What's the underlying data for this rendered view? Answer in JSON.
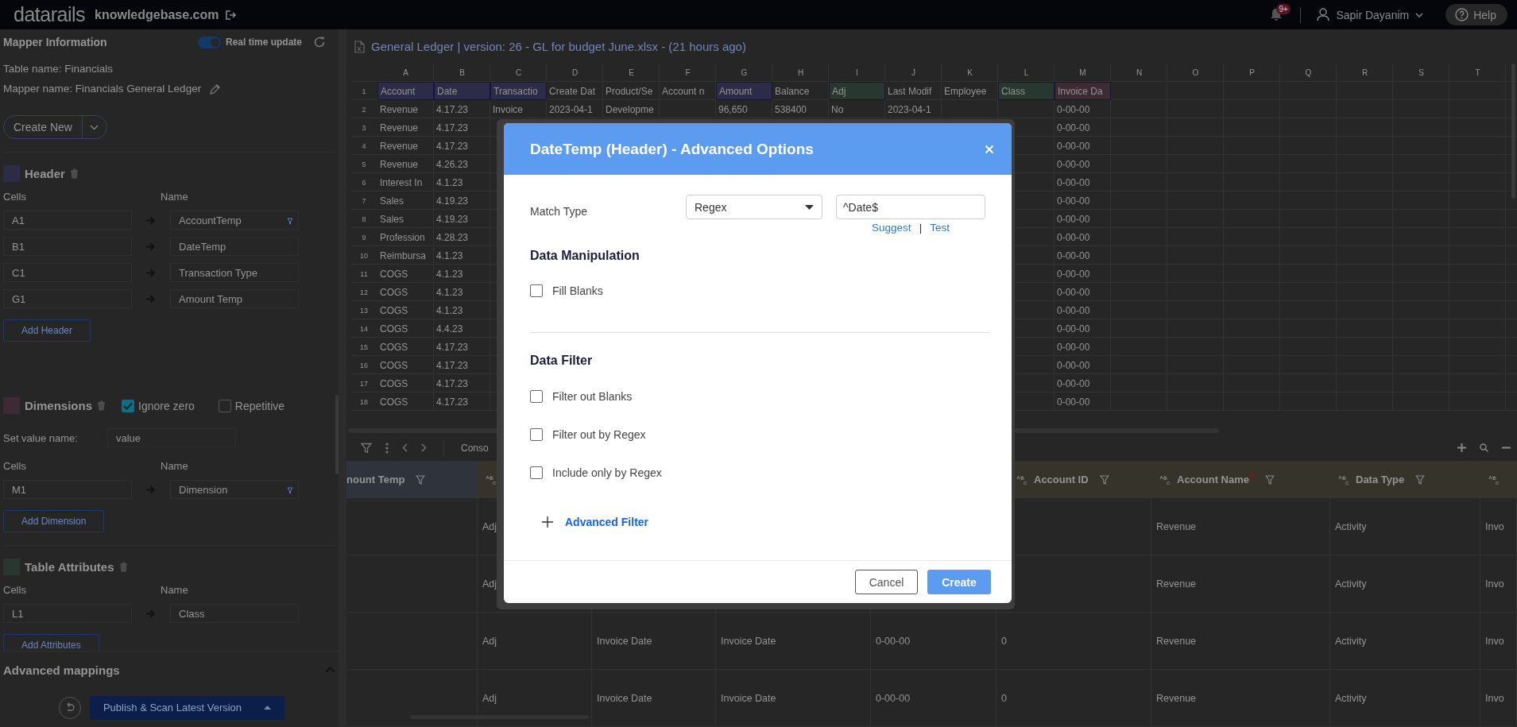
{
  "topbar": {
    "logo": "datarails",
    "domain": "knowledgebase.com",
    "badge": "9+",
    "user": "Sapir Dayanim",
    "help": "Help"
  },
  "mapper": {
    "title": "Mapper Information",
    "realtime": {
      "label": "Real time update",
      "on": true
    },
    "table_name": "Table name: Financials",
    "mapper_name": "Mapper name: Financials General Ledger",
    "create_button": "Create New",
    "sections": [
      {
        "title": "Header",
        "color": "#2c2c48",
        "cells_label": "Cells",
        "name_label": "Name",
        "rows": [
          {
            "cell": "A1",
            "name": "AccountTemp",
            "dropdown": true
          },
          {
            "cell": "B1",
            "name": "DateTemp",
            "dropdown": false
          },
          {
            "cell": "C1",
            "name": "Transaction Type",
            "dropdown": false
          },
          {
            "cell": "G1",
            "name": "Amount Temp",
            "dropdown": false
          }
        ],
        "add_button": "Add Header"
      },
      {
        "title": "Dimensions",
        "color": "#3c2a35",
        "options": [
          {
            "label": "Ignore zero",
            "checked": true
          },
          {
            "label": "Repetitive",
            "checked": false
          }
        ],
        "value_label": "Set value name:",
        "value": "value",
        "cells_label": "Cells",
        "name_label": "Name",
        "rows": [
          {
            "cell": "M1",
            "name": "Dimension",
            "dropdown": true
          }
        ],
        "add_button": "Add Dimension"
      },
      {
        "title": "Table Attributes",
        "color": "#283830",
        "cells_label": "Cells",
        "name_label": "Name",
        "rows": [
          {
            "cell": "L1",
            "name": "Class",
            "dropdown": false
          }
        ],
        "add_button": "Add Attributes"
      }
    ],
    "advanced": {
      "title": "Advanced mappings",
      "expanded": true
    },
    "publish_button": "Publish & Scan Latest Version"
  },
  "sheet": {
    "title": "General Ledger | version: 26 - GL for budget June.xlsx - (21 hours ago)",
    "columns": [
      "A",
      "B",
      "C",
      "D",
      "E",
      "F",
      "G",
      "H",
      "I",
      "J",
      "K",
      "L",
      "M",
      "N",
      "O",
      "P",
      "Q",
      "R",
      "S",
      "T"
    ],
    "rows": [
      {
        "number": "1",
        "cells": [
          {
            "text": "Account",
            "color": "#2c2c48"
          },
          {
            "text": "Date",
            "color": "#2c2c48"
          },
          {
            "text": "Transactio",
            "color": "#2c2c48"
          },
          {
            "text": "Create Dat"
          },
          {
            "text": "Product/Se"
          },
          {
            "text": "Account n"
          },
          {
            "text": "Amount",
            "color": "#2c2c48"
          },
          {
            "text": "Balance"
          },
          {
            "text": "Adj",
            "color": "#283830"
          },
          {
            "text": "Last Modif"
          },
          {
            "text": "Employee"
          },
          {
            "text": "Class",
            "color": "#283830"
          },
          {
            "text": "Invoice Da",
            "color": "#3c2a35"
          }
        ]
      },
      {
        "number": "2",
        "cells": [
          "Revenue",
          "4.17.23",
          "Invoice",
          "2023-04-1",
          "Developme",
          null,
          "96,650",
          "538400",
          "No",
          "2023-04-1",
          null,
          null,
          "0-00-00"
        ]
      },
      {
        "number": "3",
        "cells": [
          "Revenue",
          "4.17.23",
          null,
          null,
          null,
          null,
          null,
          null,
          null,
          null,
          null,
          null,
          "0-00-00"
        ]
      },
      {
        "number": "4",
        "cells": [
          "Revenue",
          "4.17.23",
          null,
          null,
          null,
          null,
          null,
          null,
          null,
          null,
          null,
          null,
          "0-00-00"
        ]
      },
      {
        "number": "5",
        "cells": [
          "Revenue",
          "4.26.23",
          null,
          null,
          null,
          null,
          null,
          null,
          null,
          null,
          null,
          null,
          "0-00-00"
        ]
      },
      {
        "number": "6",
        "cells": [
          "Interest In",
          "4.1.23",
          null,
          null,
          null,
          null,
          null,
          null,
          null,
          null,
          null,
          null,
          "0-00-00"
        ]
      },
      {
        "number": "7",
        "cells": [
          "Sales",
          "4.19.23",
          null,
          null,
          null,
          null,
          null,
          null,
          null,
          null,
          null,
          null,
          "0-00-00"
        ]
      },
      {
        "number": "8",
        "cells": [
          "Sales",
          "4.19.23",
          null,
          null,
          null,
          null,
          null,
          null,
          null,
          null,
          null,
          null,
          "0-00-00"
        ]
      },
      {
        "number": "9",
        "cells": [
          "Profession",
          "4.28.23",
          null,
          null,
          null,
          null,
          null,
          null,
          null,
          null,
          null,
          null,
          "0-00-00"
        ]
      },
      {
        "number": "10",
        "cells": [
          "Reimbursa",
          "4.1.23",
          null,
          null,
          null,
          null,
          null,
          null,
          null,
          null,
          null,
          null,
          "0-00-00"
        ]
      },
      {
        "number": "11",
        "cells": [
          "COGS",
          "4.1.23",
          null,
          null,
          null,
          null,
          null,
          null,
          null,
          null,
          null,
          null,
          "0-00-00"
        ]
      },
      {
        "number": "12",
        "cells": [
          "COGS",
          "4.1.23",
          null,
          null,
          null,
          null,
          null,
          null,
          null,
          null,
          null,
          null,
          "0-00-00"
        ]
      },
      {
        "number": "13",
        "cells": [
          "COGS",
          "4.1.23",
          null,
          null,
          null,
          null,
          null,
          null,
          null,
          null,
          null,
          null,
          "0-00-00"
        ]
      },
      {
        "number": "14",
        "cells": [
          "COGS",
          "4.4.23",
          null,
          null,
          null,
          null,
          null,
          null,
          null,
          null,
          null,
          null,
          "0-00-00"
        ]
      },
      {
        "number": "15",
        "cells": [
          "COGS",
          "4.17.23",
          null,
          null,
          null,
          null,
          null,
          null,
          null,
          null,
          null,
          null,
          "0-00-00"
        ]
      },
      {
        "number": "16",
        "cells": [
          "COGS",
          "4.17.23",
          null,
          null,
          null,
          null,
          null,
          null,
          null,
          null,
          null,
          null,
          "0-00-00"
        ]
      },
      {
        "number": "17",
        "cells": [
          "COGS",
          "4.17.23",
          null,
          null,
          null,
          null,
          null,
          null,
          null,
          null,
          null,
          null,
          "0-00-00"
        ]
      },
      {
        "number": "18",
        "cells": [
          "COGS",
          "4.17.23",
          null,
          null,
          null,
          null,
          null,
          null,
          null,
          null,
          null,
          null,
          "0-00-00"
        ]
      }
    ]
  },
  "grid": {
    "tab": "Conso",
    "columns": [
      {
        "title": "nount Temp",
        "filter": true,
        "color": "#2e333c"
      },
      {
        "type_icon": true,
        "color": "#35332a"
      },
      {},
      {},
      {},
      {
        "title": "Account ID",
        "type_icon": true,
        "filter": true,
        "color": "#35332a"
      },
      {
        "title": "Account Name",
        "type_icon": true,
        "filter": true,
        "required": true,
        "color": "#35332a"
      },
      {
        "title": "Data Type",
        "type_icon": true,
        "filter": true,
        "color": "#35332a"
      },
      {
        "type_icon": true,
        "color": "#35332a"
      }
    ],
    "rows": [
      {
        "cells": [
          null,
          "Adj",
          null,
          null,
          null,
          null,
          "Revenue",
          "Activity",
          "Invo"
        ]
      },
      {
        "cells": [
          null,
          "Adj",
          null,
          null,
          null,
          null,
          "Revenue",
          "Activity",
          "Invo"
        ]
      },
      {
        "cells": [
          null,
          "Adj",
          "Invoice Date",
          "Invoice Date",
          "0-00-00",
          "0",
          "Revenue",
          "Activity",
          "Invo"
        ]
      },
      {
        "cells": [
          null,
          "Adj",
          "Invoice Date",
          "Invoice Date",
          "0-00-00",
          "0",
          "Revenue",
          "Activity",
          "Invo"
        ]
      }
    ]
  },
  "modal": {
    "title": "DateTemp (Header) - Advanced Options",
    "match_label": "Match Type",
    "match_type": "Regex",
    "pattern": "^Date$",
    "links": [
      "Suggest",
      "Test"
    ],
    "separator": "|",
    "sections": [
      {
        "title": "Data Manipulation",
        "options": [
          {
            "label": "Fill Blanks",
            "checked": false
          }
        ]
      },
      {
        "title": "Data Filter",
        "options": [
          {
            "label": "Filter out Blanks",
            "checked": false
          },
          {
            "label": "Filter out by Regex",
            "checked": false
          },
          {
            "label": "Include only by Regex",
            "checked": false
          }
        ]
      }
    ],
    "advanced_filter": "Advanced Filter",
    "cancel": "Cancel",
    "create": "Create"
  }
}
